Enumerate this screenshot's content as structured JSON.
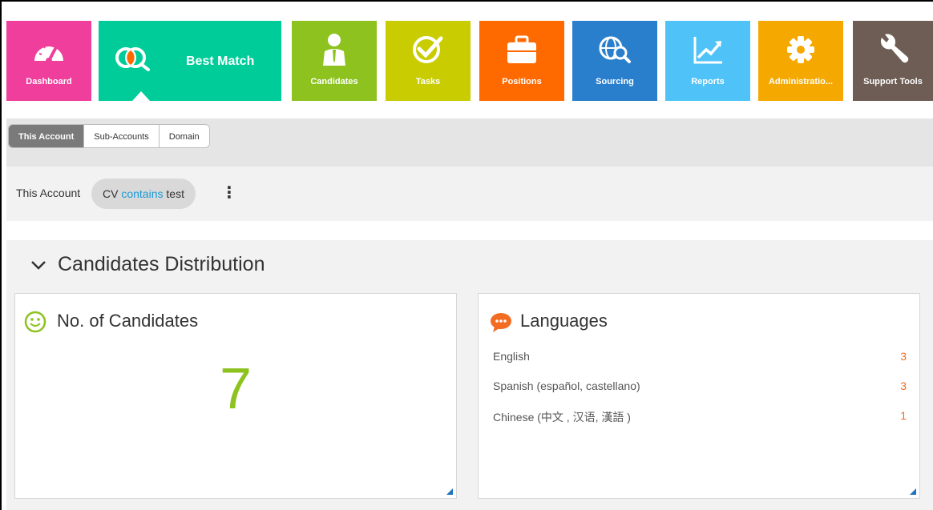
{
  "nav": {
    "tiles": [
      {
        "label": "Dashboard",
        "icon": "speedometer-icon",
        "color": "#ef3e9c"
      },
      {
        "label": "Best Match",
        "icon": "best-match-icon",
        "color": "#00cc99"
      },
      {
        "label": "Candidates",
        "icon": "person-icon",
        "color": "#8dc21f"
      },
      {
        "label": "Tasks",
        "icon": "check-circle-icon",
        "color": "#c8cc00"
      },
      {
        "label": "Positions",
        "icon": "briefcase-icon",
        "color": "#ff6a00"
      },
      {
        "label": "Sourcing",
        "icon": "globe-search-icon",
        "color": "#2a7fcc"
      },
      {
        "label": "Reports",
        "icon": "chart-icon",
        "color": "#4fc3f7"
      },
      {
        "label": "Administratio...",
        "icon": "gear-icon",
        "color": "#f5a800"
      },
      {
        "label": "Support Tools",
        "icon": "wrench-icon",
        "color": "#6d5d55"
      }
    ]
  },
  "scope": {
    "tabs": [
      "This Account",
      "Sub-Accounts",
      "Domain"
    ],
    "active": "This Account"
  },
  "filter": {
    "label": "This Account",
    "chip_field": "CV",
    "chip_operator": "contains",
    "chip_value": "test"
  },
  "section": {
    "title": "Candidates Distribution"
  },
  "cards": {
    "candidates": {
      "title": "No. of Candidates",
      "value": "7",
      "icon": "smiley-icon"
    },
    "languages": {
      "title": "Languages",
      "icon": "chat-bubble-icon",
      "rows": [
        {
          "name": "English",
          "count": "3"
        },
        {
          "name": "Spanish (español, castellano)",
          "count": "3"
        },
        {
          "name": "Chinese (中文 , 汉语, 漢語 )",
          "count": "1"
        }
      ]
    }
  }
}
